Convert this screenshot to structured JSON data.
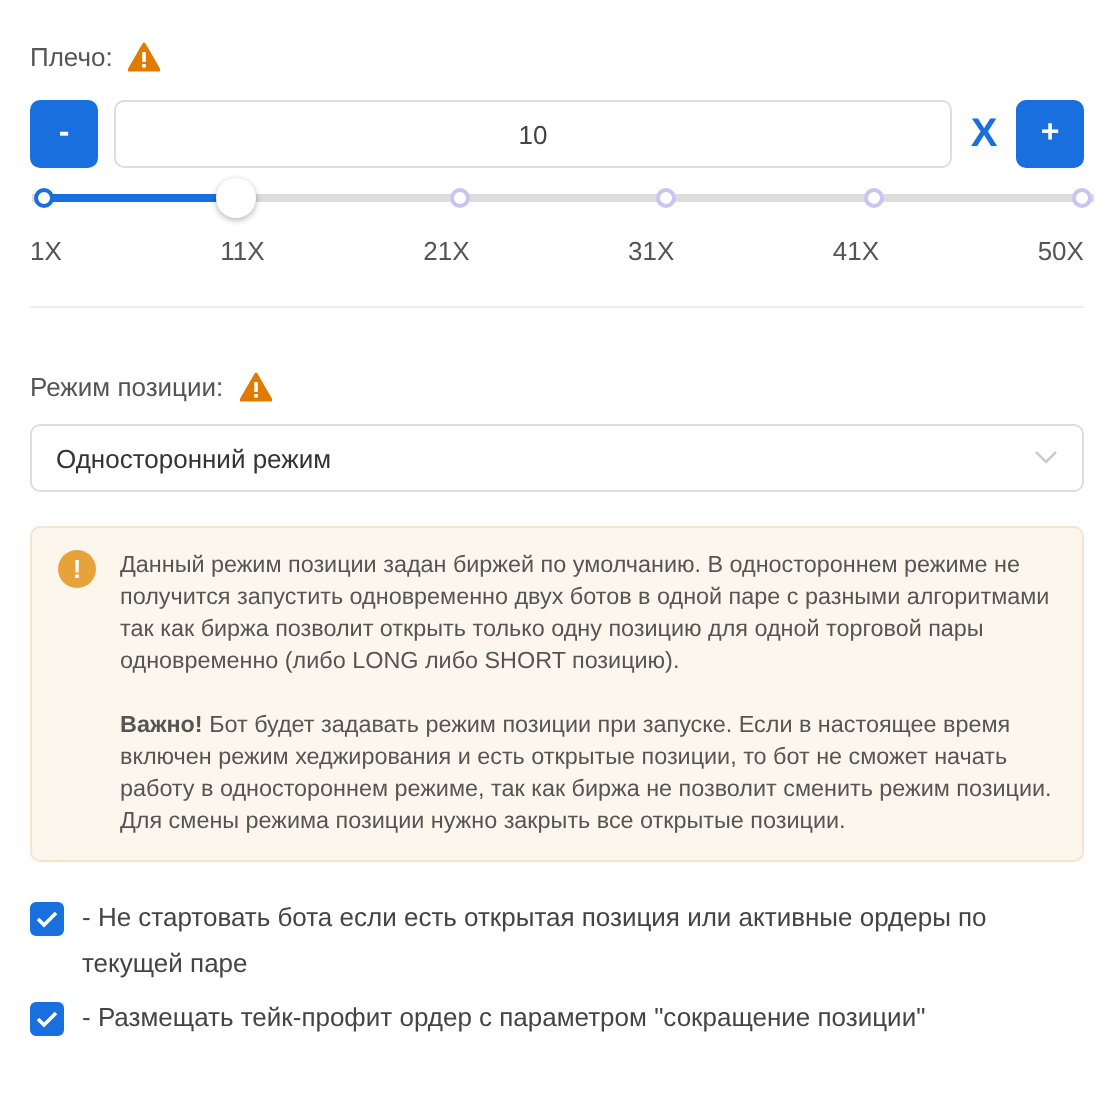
{
  "leverage": {
    "label": "Плечо:",
    "minus": "-",
    "value": "10",
    "unit": "X",
    "plus": "+",
    "level": 0.185,
    "ticks": [
      "1X",
      "11X",
      "21X",
      "31X",
      "41X",
      "50X"
    ]
  },
  "position_mode": {
    "label": "Режим позиции:",
    "value": "Односторонний режим"
  },
  "alert": {
    "icon": "!",
    "paragraphs": [
      "Данный режим позиции задан биржей по умолчанию. В одностороннем режиме не получится запустить одновременно двух ботов в одной паре с разными алгоритмами так как биржа позволит открыть только одну позицию для одной торговой пары одновременно (либо LONG либо SHORT позицию).",
      "**Важно!** Бот будет задавать режим позиции при запуске. Если в настоящее время включен режим хеджирования и есть открытые позиции, то бот не сможет начать работу в одностороннем режиме, так как биржа не позволит сменить режим позиции. Для смены режима позиции нужно закрыть все открытые позиции."
    ]
  },
  "options": [
    {
      "label": "- Не стартовать бота если есть открытая позиция или активные ордеры по текущей паре",
      "checked": true
    },
    {
      "label": "- Размещать тейк-профит ордер с параметром \"сокращение позиции\"",
      "checked": true
    }
  ]
}
